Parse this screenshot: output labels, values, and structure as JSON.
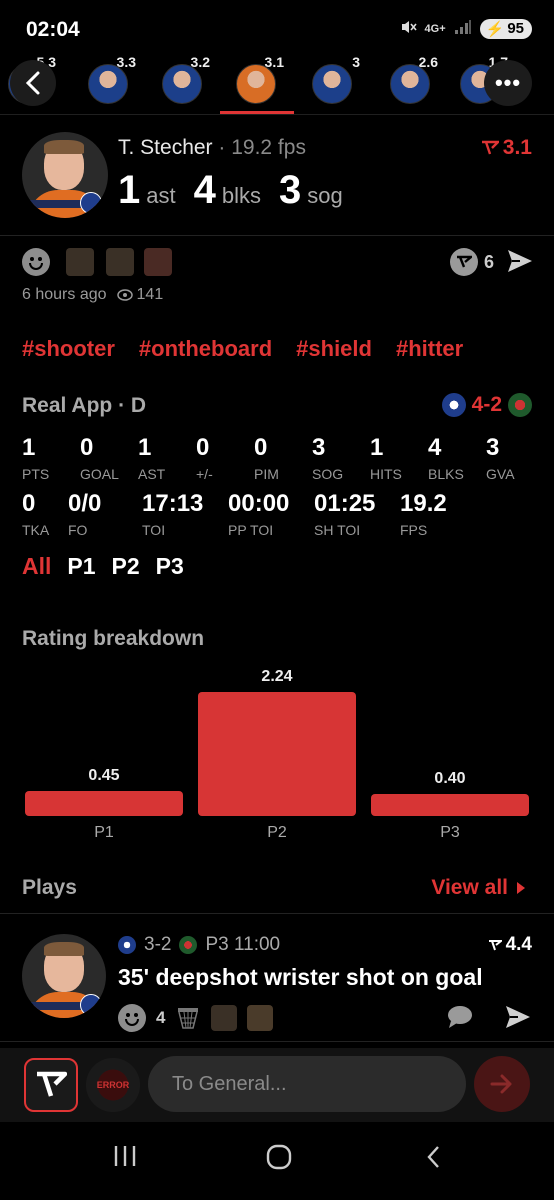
{
  "status_bar": {
    "time": "02:04",
    "network": "4G+",
    "battery": "95"
  },
  "player_strip": {
    "players": [
      {
        "rating": "5.3"
      },
      {
        "rating": "3.3"
      },
      {
        "rating": "3.2"
      },
      {
        "rating": "3.1",
        "active": true
      },
      {
        "rating": "3"
      },
      {
        "rating": "2.6"
      },
      {
        "rating": "1.7"
      }
    ]
  },
  "header": {
    "player_name": "T. Stecher",
    "fps_text": "· 19.2 fps",
    "rating": "3.1",
    "statline": [
      {
        "value": "1",
        "label": "ast"
      },
      {
        "value": "4",
        "label": "blks"
      },
      {
        "value": "3",
        "label": "sog"
      }
    ]
  },
  "reactions": {
    "count": "6",
    "time_ago": "6 hours ago",
    "views": "141"
  },
  "tags": [
    "#shooter",
    "#ontheboard",
    "#shield",
    "#hitter"
  ],
  "game": {
    "title": "Real App · D",
    "score": "4-2",
    "row1": [
      {
        "v": "1",
        "k": "PTS"
      },
      {
        "v": "0",
        "k": "GOAL"
      },
      {
        "v": "1",
        "k": "AST"
      },
      {
        "v": "0",
        "k": "+/-"
      },
      {
        "v": "0",
        "k": "PIM"
      },
      {
        "v": "3",
        "k": "SOG"
      },
      {
        "v": "1",
        "k": "HITS"
      },
      {
        "v": "4",
        "k": "BLKS"
      },
      {
        "v": "3",
        "k": "GVA"
      }
    ],
    "row2": [
      {
        "v": "0",
        "k": "TKA"
      },
      {
        "v": "0/0",
        "k": "FO"
      },
      {
        "v": "17:13",
        "k": "TOI"
      },
      {
        "v": "00:00",
        "k": "PP TOI"
      },
      {
        "v": "01:25",
        "k": "SH TOI"
      },
      {
        "v": "19.2",
        "k": "FPS"
      }
    ],
    "periods": [
      "All",
      "P1",
      "P2",
      "P3"
    ],
    "selected_period": "All"
  },
  "rating_breakdown": {
    "title": "Rating breakdown"
  },
  "chart_data": {
    "type": "bar",
    "categories": [
      "P1",
      "P2",
      "P3"
    ],
    "values": [
      0.45,
      2.24,
      0.4
    ],
    "value_labels": [
      "0.45",
      "2.24",
      "0.40"
    ],
    "title": "Rating breakdown",
    "ylim": [
      0,
      2.24
    ]
  },
  "plays": {
    "title": "Plays",
    "view_all": "View all",
    "items": [
      {
        "score": "3-2",
        "period_time": "P3 11:00",
        "rating": "4.4",
        "description": "35' deepshot wrister shot on goal",
        "reaction_count": "4"
      }
    ]
  },
  "composer": {
    "placeholder": "To General...",
    "group_badge": "ERROR"
  },
  "colors": {
    "accent": "#e03535",
    "background": "#000000",
    "bar": "#d73535"
  }
}
